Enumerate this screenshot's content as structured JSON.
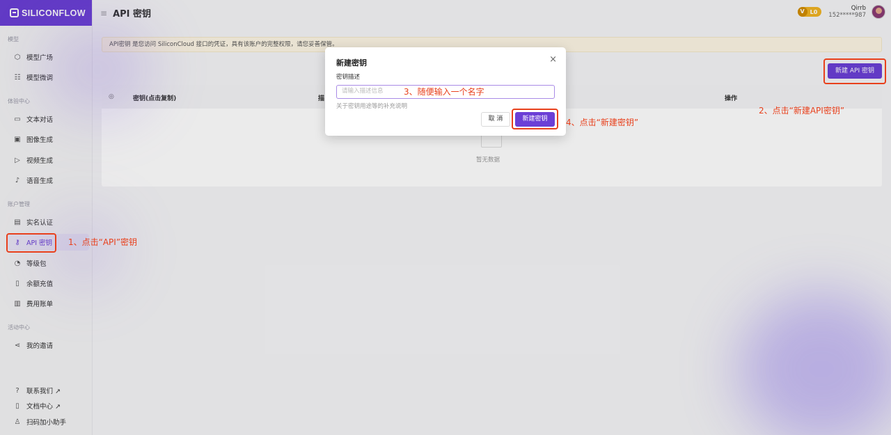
{
  "app": {
    "logo_text": "SILICONFLOW"
  },
  "header": {
    "title": "API 密钥"
  },
  "user": {
    "name": "Qirrb",
    "phone": "152*****987",
    "level": "L0"
  },
  "sidebar": {
    "sections": [
      {
        "title": "模型",
        "items": [
          {
            "label": "模型广场",
            "icon": "cube-icon"
          },
          {
            "label": "模型微调",
            "icon": "sliders-icon"
          }
        ]
      },
      {
        "title": "体验中心",
        "items": [
          {
            "label": "文本对话",
            "icon": "chat-icon"
          },
          {
            "label": "图像生成",
            "icon": "image-icon"
          },
          {
            "label": "视频生成",
            "icon": "video-icon"
          },
          {
            "label": "语音生成",
            "icon": "mic-icon"
          }
        ]
      },
      {
        "title": "账户管理",
        "items": [
          {
            "label": "实名认证",
            "icon": "id-card-icon"
          },
          {
            "label": "API 密钥",
            "icon": "key-icon",
            "active": true
          },
          {
            "label": "等级包",
            "icon": "gauge-icon"
          },
          {
            "label": "余额充值",
            "icon": "recharge-icon"
          },
          {
            "label": "费用账单",
            "icon": "bill-icon"
          }
        ]
      },
      {
        "title": "活动中心",
        "items": [
          {
            "label": "我的邀请",
            "icon": "share-icon"
          }
        ]
      }
    ],
    "footer": [
      {
        "label": "联系我们 ↗",
        "icon": "help-icon"
      },
      {
        "label": "文档中心 ↗",
        "icon": "book-icon"
      },
      {
        "label": "扫码加小助手",
        "icon": "user-icon"
      }
    ]
  },
  "main": {
    "notice": "API密钥 是您访问 SiliconCloud 接口的凭证，具有该账户的完整权限，请您妥善保管。",
    "new_key_button": "新建 API 密钥",
    "table": {
      "columns": [
        "密钥(点击复制)",
        "描",
        "操作"
      ],
      "empty_text": "暂无数据"
    }
  },
  "modal": {
    "title": "新建密钥",
    "close": "×",
    "field_label": "密钥描述",
    "placeholder": "请输入描述信息",
    "help": "关于密钥用途等的补充说明",
    "cancel": "取 消",
    "create": "新建密钥"
  },
  "annotations": {
    "step1": "1、点击“API”密钥",
    "step2": "2、点击“新建API密钥”",
    "step3": "3、随便输入一个名字",
    "step4": "4、点击“新建密钥”",
    "color": "#e8401c"
  },
  "colors": {
    "brand": "#6b3fd6",
    "notice_bg": "#fdf6e4"
  }
}
